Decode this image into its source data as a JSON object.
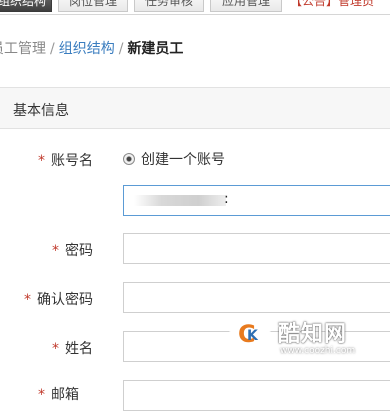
{
  "tabs": [
    {
      "label": "组织结构"
    },
    {
      "label": "岗位管理"
    },
    {
      "label": "任务审核"
    },
    {
      "label": "应用管理"
    }
  ],
  "notice": "【公告】管理员",
  "breadcrumb": {
    "root": "员工管理",
    "parent": "组织结构",
    "current": "新建员工"
  },
  "panel": {
    "title": "基本信息"
  },
  "form": {
    "account_label": "账号名",
    "account_option": "创建一个账号",
    "account_value": "",
    "password_label": "密码",
    "confirm_label": "确认密码",
    "name_label": "姓名",
    "next_label": "邮箱"
  },
  "watermark": {
    "name": "酷知网",
    "url": "www.coozhi.com"
  }
}
